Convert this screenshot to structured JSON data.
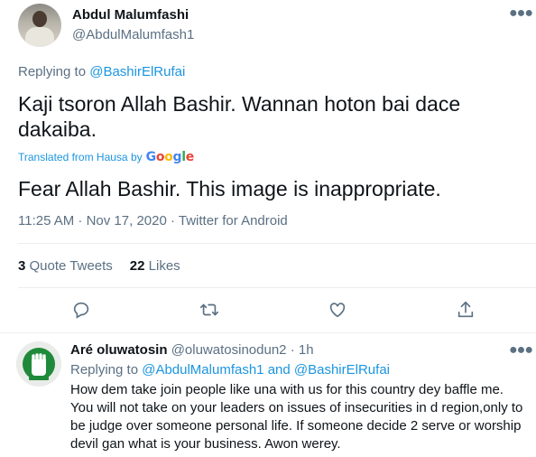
{
  "main_tweet": {
    "display_name": "Abdul Malumfashi",
    "handle": "@AbdulMalumfash1",
    "replying_prefix": "Replying to",
    "replying_to": "@BashirElRufai",
    "text": "Kaji tsoron Allah Bashir. Wannan hoton bai dace dakaiba.",
    "translated_from": "Translated from Hausa by",
    "google_logo": [
      "G",
      "o",
      "o",
      "g",
      "l",
      "e"
    ],
    "translation": "Fear Allah Bashir. This image is inappropriate.",
    "timestamp": "11:25 AM · Nov 17, 2020 · Twitter for Android",
    "quote_count": "3",
    "quote_label": "Quote Tweets",
    "like_count": "22",
    "like_label": "Likes",
    "more_icon": "more-icon"
  },
  "actions": [
    {
      "name": "reply-icon"
    },
    {
      "name": "retweet-icon"
    },
    {
      "name": "like-icon"
    },
    {
      "name": "share-icon"
    }
  ],
  "reply_tweet": {
    "display_name": "Aré oluwatosin",
    "handle": "@oluwatosinodun2",
    "time": "· 1h",
    "replying_prefix": "Replying to",
    "replying_to_1": "@AbdulMalumfash1",
    "and": "and",
    "replying_to_2": "@BashirElRufai",
    "text": "How dem take join people like una with us for this country dey baffle me. You will not take on your leaders on issues of insecurities in d region,only to be judge over someone personal life. If someone decide 2 serve or worship devil gan what is your business. Awon werey."
  },
  "colors": {
    "link": "#1b95e0",
    "secondary": "#5b7083",
    "text": "#0f1419"
  }
}
